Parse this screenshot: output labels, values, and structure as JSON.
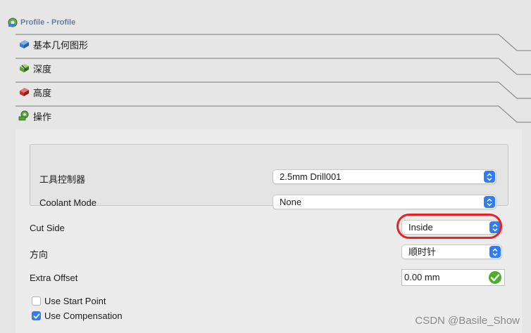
{
  "panel": {
    "title": "Profile - Profile",
    "icon": "profile-gear-icon"
  },
  "sections": [
    {
      "label": "基本几何图形",
      "icon": "base-geometry-icon",
      "color": "#3d7fc9"
    },
    {
      "label": "深度",
      "icon": "depth-icon",
      "color": "#5aa03a"
    },
    {
      "label": "高度",
      "icon": "height-icon",
      "color": "#c8332f"
    },
    {
      "label": "操作",
      "icon": "operation-gear-icon",
      "color": "#5aa03a"
    }
  ],
  "operation": {
    "tool_controller_label": "工具控制器",
    "tool_controller_value": "2.5mm Drill001",
    "coolant_mode_label": "Coolant Mode",
    "coolant_mode_value": "None",
    "cut_side_label": "Cut Side",
    "cut_side_value": "Inside",
    "direction_label": "方向",
    "direction_value": "顺时针",
    "extra_offset_label": "Extra Offset",
    "extra_offset_value": "0.00 mm",
    "use_start_point_label": "Use Start Point",
    "use_start_point_checked": false,
    "use_compensation_label": "Use Compensation",
    "use_compensation_checked": true
  },
  "colors": {
    "accent": "#2f7cf6",
    "highlight": "#e8231f",
    "valid": "#4caf2a"
  },
  "watermark": "CSDN @Basile_Show"
}
